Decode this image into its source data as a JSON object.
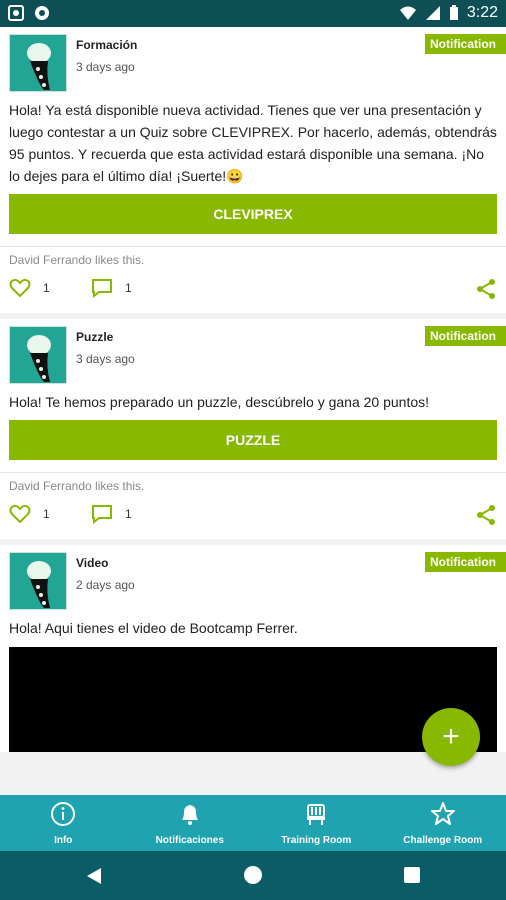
{
  "status_bar": {
    "time": "3:22"
  },
  "posts": [
    {
      "title": "Formación",
      "date": "3 days ago",
      "badge": "Notification",
      "body": "Hola! Ya está disponible nueva actividad. Tienes que ver una presentación y luego contestar a un Quiz sobre CLEVIPREX. Por hacerlo, además, obtendrás 95 puntos. Y recuerda que esta actividad estará disponible una semana. ¡No lo dejes para el último día! ¡Suerte!😀",
      "button_label": "CLEVIPREX",
      "likes_text": "David Ferrando likes this.",
      "like_count": "1",
      "comment_count": "1"
    },
    {
      "title": "Puzzle",
      "date": "3 days ago",
      "badge": "Notification",
      "body": "Hola! Te hemos preparado un puzzle, descúbrelo y gana 20 puntos!",
      "button_label": "PUZZLE",
      "likes_text": "David Ferrando likes this.",
      "like_count": "1",
      "comment_count": "1"
    },
    {
      "title": "Video",
      "date": "2 days ago",
      "badge": "Notification",
      "body": "Hola! Aqui tienes el video de Bootcamp Ferrer."
    }
  ],
  "fab": {
    "icon": "plus-icon",
    "label": "+"
  },
  "bottom_nav": [
    {
      "label": "Info",
      "icon": "info-icon"
    },
    {
      "label": "Notificaciones",
      "icon": "bell-icon"
    },
    {
      "label": "Training Room",
      "icon": "training-room-icon"
    },
    {
      "label": "Challenge Room",
      "icon": "star-icon"
    }
  ],
  "colors": {
    "accent": "#88b800",
    "nav": "#1fa3b0",
    "status_bar": "#0d4f55"
  }
}
